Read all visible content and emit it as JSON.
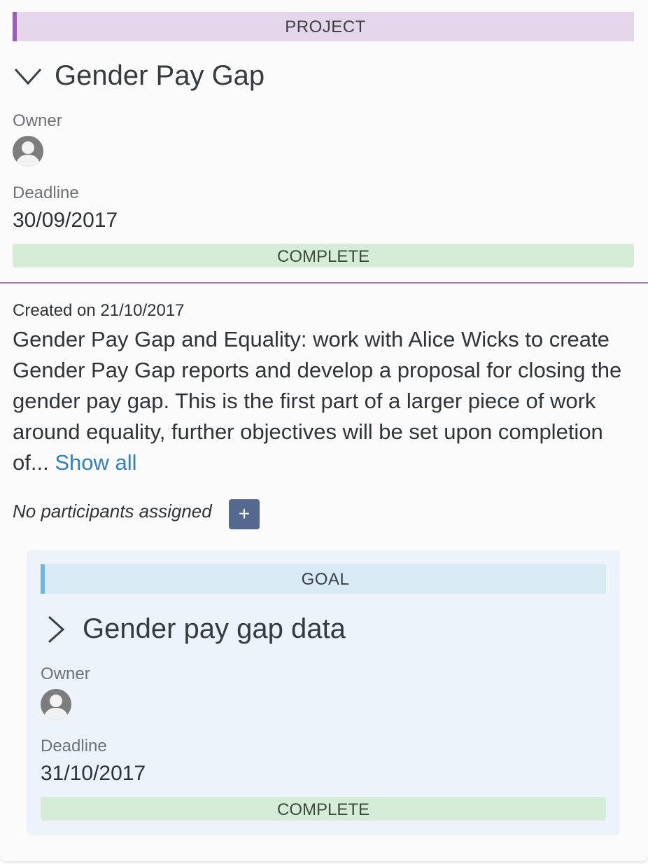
{
  "project": {
    "type_label": "PROJECT",
    "title": "Gender Pay Gap",
    "owner_label": "Owner",
    "deadline_label": "Deadline",
    "deadline": "30/09/2017",
    "status": "COMPLETE",
    "created": "Created on 21/10/2017",
    "description": "Gender Pay Gap and Equality: work with Alice Wicks to create Gender Pay Gap reports and develop a proposal for closing the gender pay gap. This is the first part of a larger piece of work around equality, further objectives will be set upon completion of...",
    "show_all": "Show all",
    "participants": "No participants assigned",
    "add_button": "+",
    "expand_icon": "chevron-down-icon",
    "owner_icon": "user-avatar-icon"
  },
  "goal": {
    "type_label": "GOAL",
    "title": "Gender pay gap data",
    "owner_label": "Owner",
    "deadline_label": "Deadline",
    "deadline": "31/10/2017",
    "status": "COMPLETE",
    "expand_icon": "chevron-right-icon",
    "owner_icon": "user-avatar-icon"
  },
  "colors": {
    "project_accent": "#9c5ebd",
    "project_bar_bg": "#e5d6eb",
    "goal_accent": "#6fb4e1",
    "goal_bar_bg": "#d8ebf5",
    "complete_bg": "#d5ecd6",
    "link": "#2f7fc1",
    "add_button_bg": "#55698f"
  }
}
